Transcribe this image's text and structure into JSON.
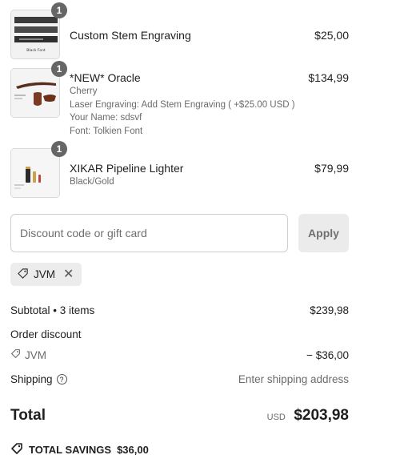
{
  "items": [
    {
      "title": "Custom Stem Engraving",
      "details": [],
      "price": "$25,00",
      "qty": "1",
      "image_caption": "Black Font"
    },
    {
      "title": "*NEW* Oracle",
      "details": [
        "Cherry",
        "Laser Engraving: Add Stem Engraving ( +$25.00 USD )",
        "Your Name: sdsvf",
        "Font: Tolkien Font"
      ],
      "price": "$134,99",
      "qty": "1"
    },
    {
      "title": "XIKAR Pipeline Lighter",
      "details": [
        "Black/Gold"
      ],
      "price": "$79,99",
      "qty": "1"
    }
  ],
  "discount": {
    "placeholder": "Discount code or gift card",
    "value": "",
    "apply_label": "Apply"
  },
  "applied_code": {
    "code": "JVM"
  },
  "summary": {
    "subtotal_label": "Subtotal • 3 items",
    "subtotal_value": "$239,98",
    "order_discount_label": "Order discount",
    "discount_code": "JVM",
    "discount_value": "− $36,00",
    "shipping_label": "Shipping",
    "shipping_value": "Enter shipping address",
    "total_label": "Total",
    "currency": "USD",
    "total_value": "$203,98",
    "savings_label": "TOTAL SAVINGS",
    "savings_value": "$36,00"
  }
}
